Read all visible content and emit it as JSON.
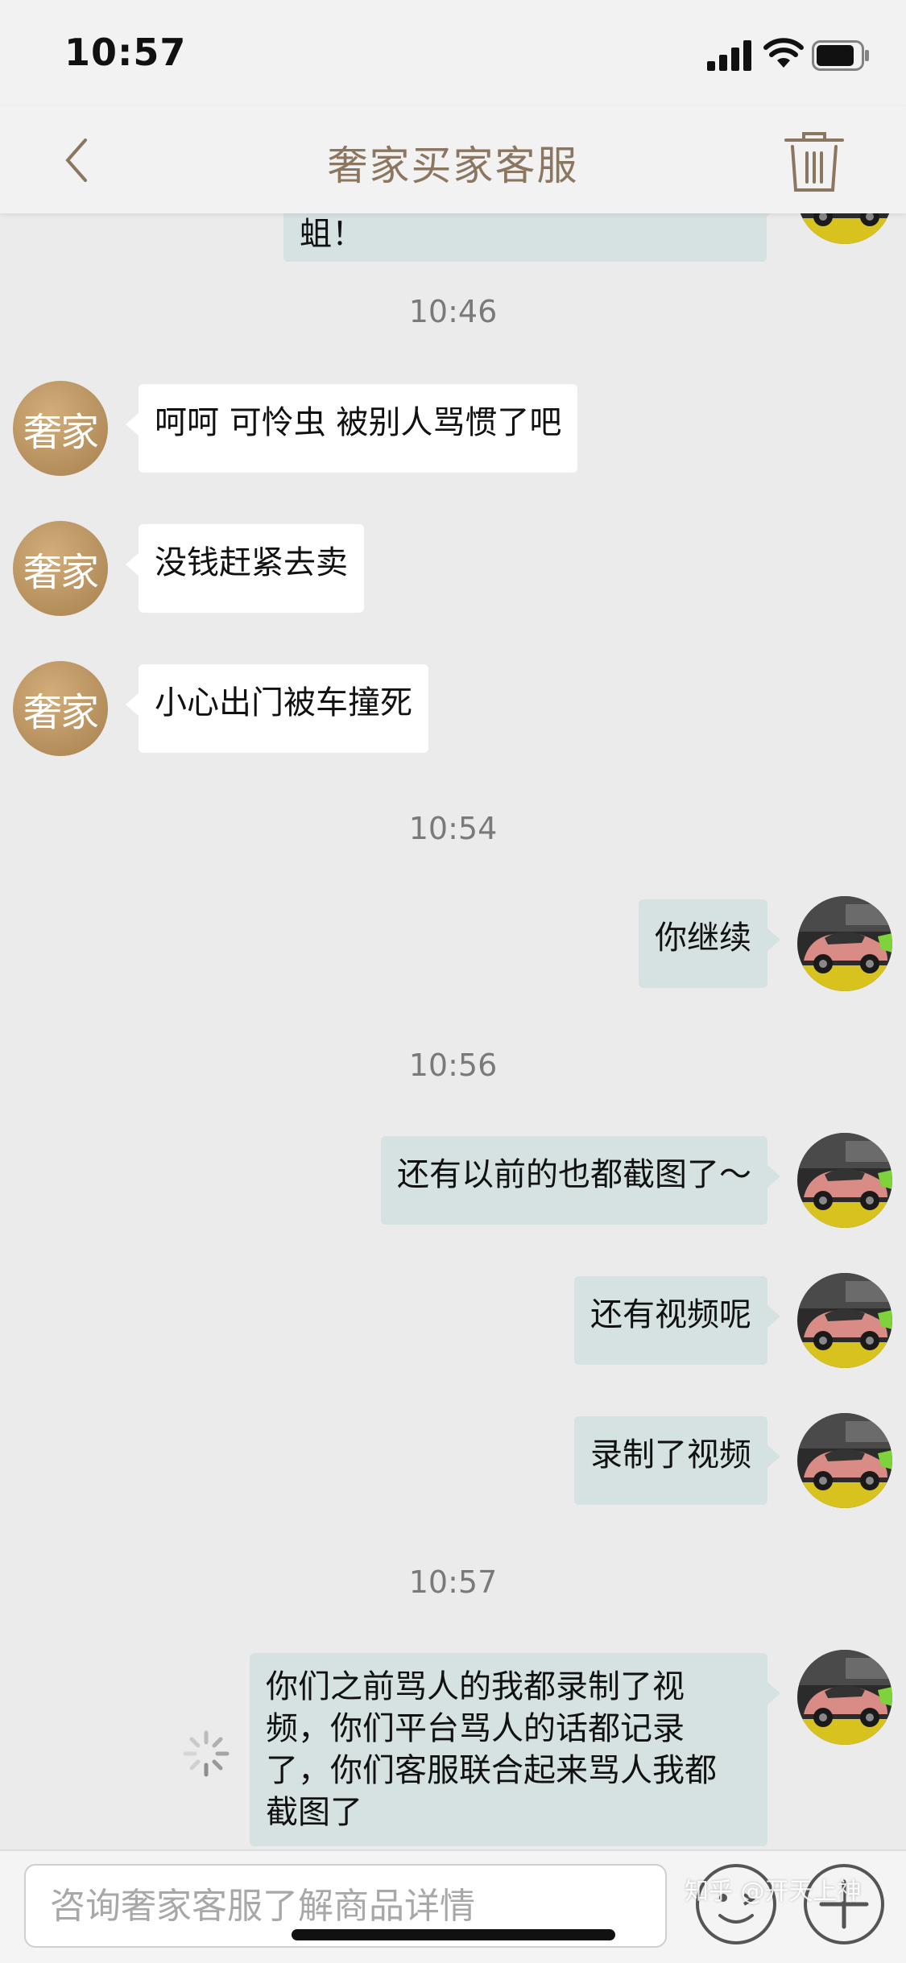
{
  "status_bar": {
    "time": "10:57"
  },
  "nav": {
    "title": "奢家买家客服"
  },
  "brand": {
    "avatar_text": "奢家",
    "accent": "#8b7660",
    "avatar_color": "#bc955f"
  },
  "messages": {
    "cut_off": "蛆！",
    "ts1": "10:46",
    "m1": "呵呵 可怜虫 被别人骂惯了吧",
    "m2": "没钱赶紧去卖",
    "m3": "小心出门被车撞死",
    "ts2": "10:54",
    "m4": "你继续",
    "ts3": "10:56",
    "m5": "还有以前的也都截图了～",
    "m6": "还有视频呢",
    "m7": "录制了视频",
    "ts4": "10:57",
    "m8_l1": "你们之前骂人的我都录制了视",
    "m8_l2": "频，你们平台骂人的话都记录",
    "m8_l3": "了，你们客服联合起来骂人我都",
    "m8_l4": "截图了"
  },
  "input": {
    "placeholder": "咨询奢家客服了解商品详情"
  },
  "watermark": "知乎 @开天上神"
}
